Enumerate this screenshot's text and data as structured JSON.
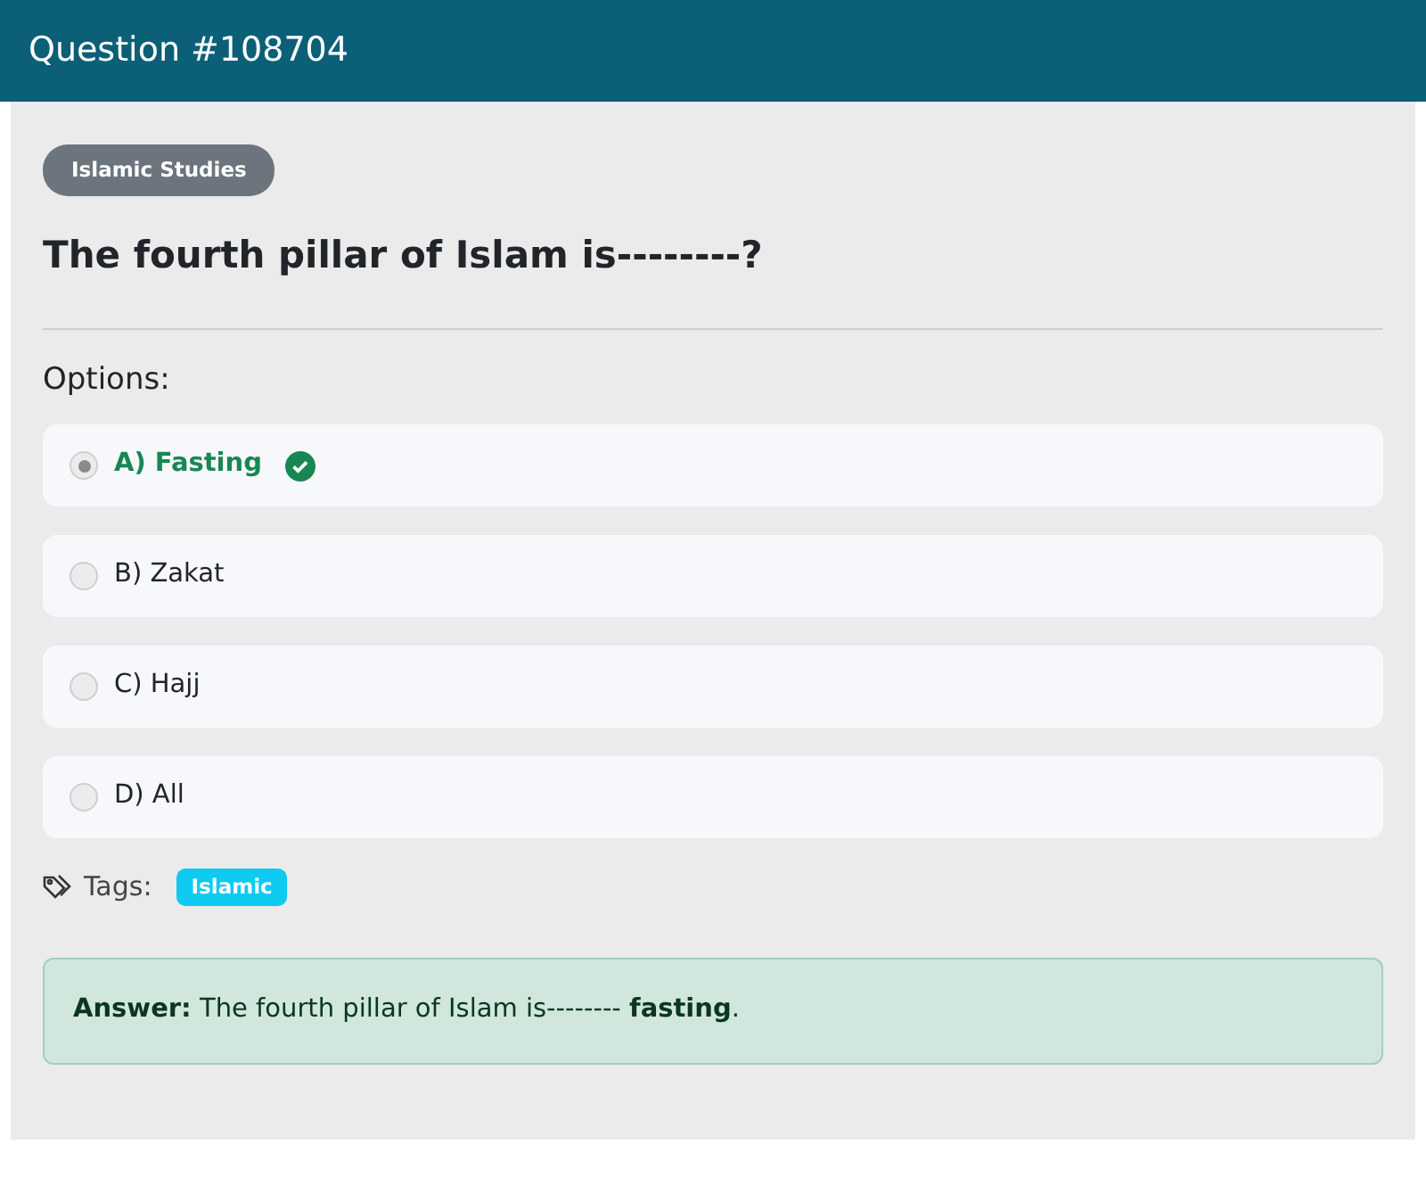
{
  "header": {
    "title": "Question #108704"
  },
  "category": "Islamic Studies",
  "question": "The fourth pillar of Islam is--------?",
  "options_label": "Options:",
  "options": [
    {
      "label": "A) Fasting",
      "selected": true,
      "correct": true
    },
    {
      "label": "B) Zakat",
      "selected": false,
      "correct": false
    },
    {
      "label": "C) Hajj",
      "selected": false,
      "correct": false
    },
    {
      "label": "D) All",
      "selected": false,
      "correct": false
    }
  ],
  "tags_label": "Tags:",
  "tags": [
    "Islamic"
  ],
  "answer": "**Answer:** The fourth pillar of Islam is-------- **fasting**."
}
